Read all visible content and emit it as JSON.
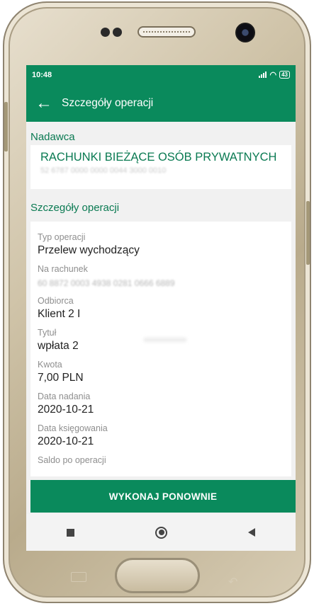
{
  "status_bar": {
    "time": "10:48",
    "battery": "43"
  },
  "app_bar": {
    "back_icon": "arrow-left-icon",
    "title": "Szczegóły operacji"
  },
  "sender": {
    "section_label": "Nadawca",
    "account_name": "RACHUNKI BIEŻĄCE OSÓB PRYWATNYCH",
    "account_number": "52 6787 0000 0000 0044 3000 0010"
  },
  "details": {
    "section_label": "Szczegóły operacji",
    "fields": [
      {
        "label": "Typ operacji",
        "value": "Przelew wychodzący"
      },
      {
        "label": "Na rachunek",
        "value": "60 8872 0003 4938 0281 0666 6889"
      },
      {
        "label": "Odbiorca",
        "value": "Klient 2 I"
      },
      {
        "label": "Tytuł",
        "value": "wpłata 2"
      },
      {
        "label": "Kwota",
        "value": "7,00 PLN"
      },
      {
        "label": "Data nadania",
        "value": "2020-10-21"
      },
      {
        "label": "Data księgowania",
        "value": "2020-10-21"
      },
      {
        "label": "Saldo po operacji",
        "value": ""
      }
    ]
  },
  "action": {
    "label": "WYKONAJ PONOWNIE"
  },
  "colors": {
    "primary": "#0a8a5c",
    "accent_text": "#0a7a52",
    "background": "#f1f1f1"
  }
}
